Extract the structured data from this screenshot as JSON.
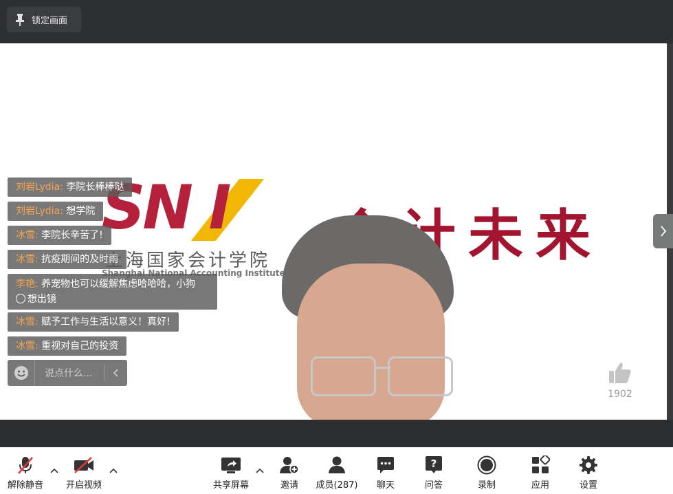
{
  "top": {
    "lock_label": "锁定画面"
  },
  "chat": {
    "messages": [
      {
        "who": "刘岩Lydia",
        "text": "李院长棒棒哒"
      },
      {
        "who": "刘岩Lydia",
        "text": "想学院"
      },
      {
        "who": "冰雪",
        "text": "李院长辛苦了!"
      },
      {
        "who": "冰雪",
        "text": "抗疫期间的及时雨"
      },
      {
        "who": "李艳",
        "text": "养宠物也可以缓解焦虑哈哈哈，小狗",
        "text2": "想出镜"
      },
      {
        "who": "冰雪",
        "text": "赋予工作与生活以意义！真好!"
      },
      {
        "who": "冰雪",
        "text": "重视对自己的投资"
      }
    ],
    "input_placeholder": "说点什么..."
  },
  "slide": {
    "logo_letters": "SN  I",
    "logo_cn": "上海国家会计学院",
    "logo_en": "Shanghai National Accounting Institute",
    "slogan": "会计未来"
  },
  "like": {
    "count": "1902"
  },
  "toolbar": {
    "unmute": "解除静音",
    "video": "开启视频",
    "share": "共享屏幕",
    "invite": "邀请",
    "members": "成员(287)",
    "chat": "聊天",
    "qa": "问答",
    "record": "录制",
    "apps": "应用",
    "settings": "设置"
  },
  "colors": {
    "accent_orange": "#f5a450",
    "brand_red": "#b5213a",
    "brand_yellow": "#f2b705"
  }
}
